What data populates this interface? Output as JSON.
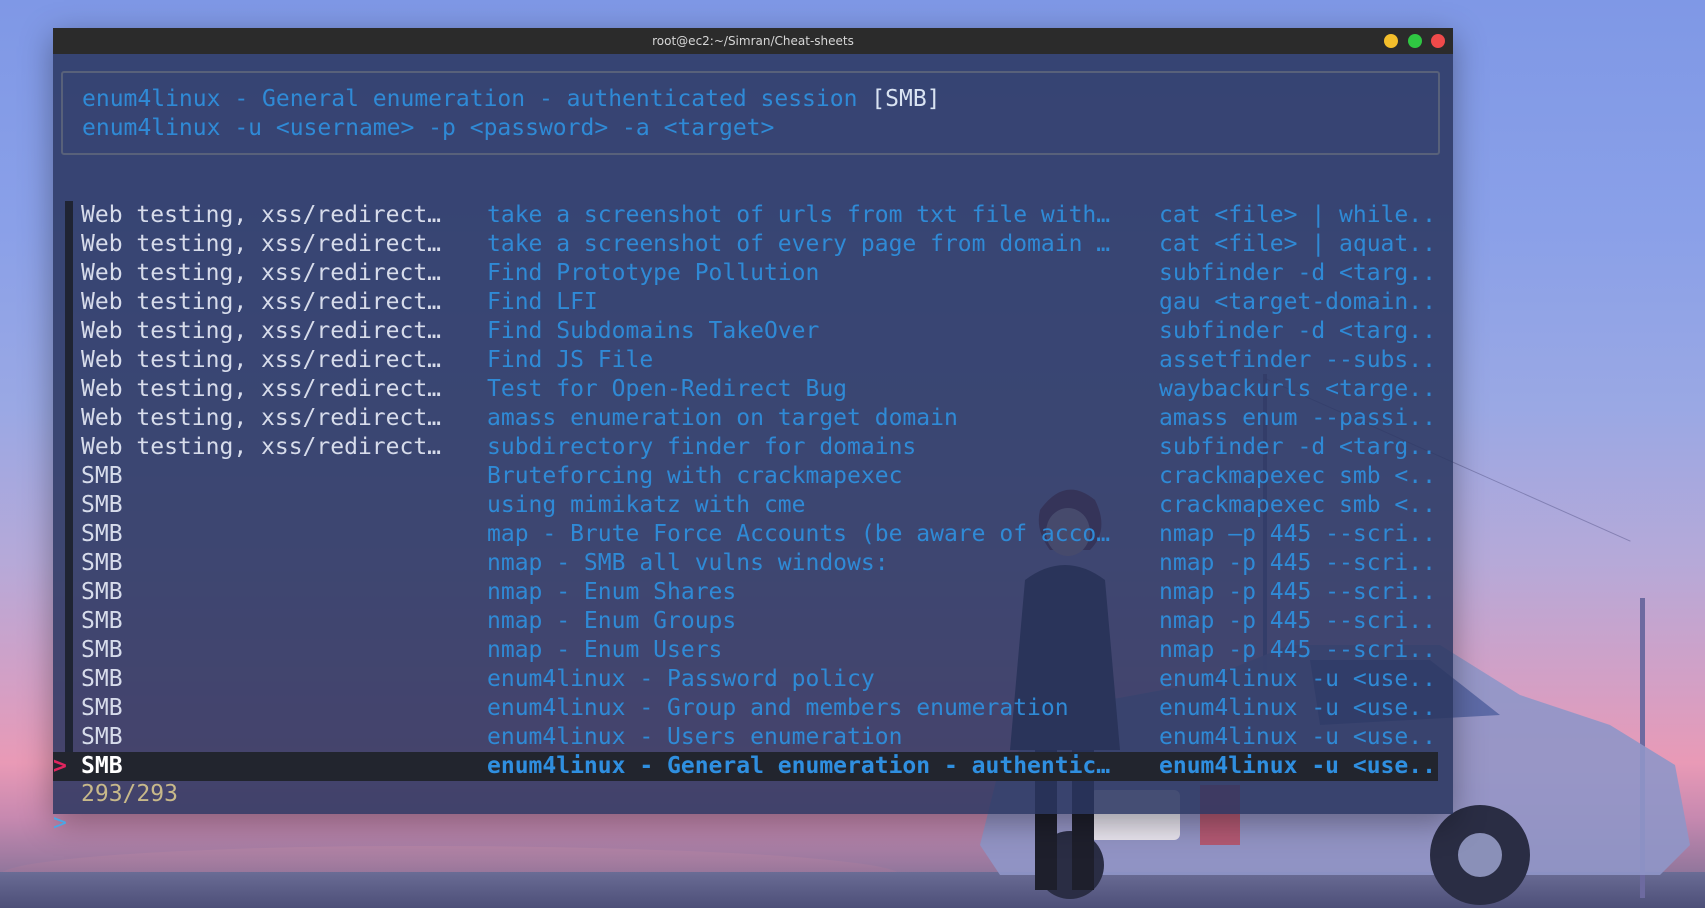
{
  "window": {
    "title": "root@ec2:~/Simran/Cheat-sheets",
    "controls": [
      "minimize",
      "maximize",
      "close"
    ]
  },
  "preview": {
    "line1": "enum4linux - General enumeration - authenticated session ",
    "tag": "[SMB]",
    "line2": "enum4linux -u <username> -p <password> -a <target>"
  },
  "rows": [
    {
      "c1": "Web testing, xss/redirect…",
      "c2": "take a screenshot of urls from txt file with…",
      "c3": "cat <file> | while.."
    },
    {
      "c1": "Web testing, xss/redirect…",
      "c2": "take a screenshot of every page from domain …",
      "c3": "cat <file> | aquat.."
    },
    {
      "c1": "Web testing, xss/redirect…",
      "c2": "Find Prototype Pollution",
      "c3": "subfinder -d <targ.."
    },
    {
      "c1": "Web testing, xss/redirect…",
      "c2": "Find LFI",
      "c3": "gau <target-domain.."
    },
    {
      "c1": "Web testing, xss/redirect…",
      "c2": "Find Subdomains TakeOver",
      "c3": "subfinder -d <targ.."
    },
    {
      "c1": "Web testing, xss/redirect…",
      "c2": "Find JS File",
      "c3": "assetfinder --subs.."
    },
    {
      "c1": "Web testing, xss/redirect…",
      "c2": "Test for Open-Redirect Bug",
      "c3": "waybackurls <targe.."
    },
    {
      "c1": "Web testing, xss/redirect…",
      "c2": "amass enumeration on target domain",
      "c3": "amass enum --passi.."
    },
    {
      "c1": "Web testing, xss/redirect…",
      "c2": "subdirectory finder for domains",
      "c3": "subfinder -d <targ.."
    },
    {
      "c1": "SMB",
      "c2": "Bruteforcing with crackmapexec",
      "c3": "crackmapexec smb <.."
    },
    {
      "c1": "SMB",
      "c2": "using mimikatz with cme",
      "c3": "crackmapexec smb <.."
    },
    {
      "c1": "SMB",
      "c2": "map - Brute Force Accounts (be aware of acco…",
      "c3": "nmap –p 445 --scri.."
    },
    {
      "c1": "SMB",
      "c2": "nmap - SMB all vulns windows:",
      "c3": "nmap -p 445 --scri.."
    },
    {
      "c1": "SMB",
      "c2": "nmap - Enum Shares",
      "c3": "nmap -p 445 --scri.."
    },
    {
      "c1": "SMB",
      "c2": "nmap - Enum Groups",
      "c3": "nmap -p 445 --scri.."
    },
    {
      "c1": "SMB",
      "c2": "nmap - Enum Users",
      "c3": "nmap -p 445 --scri.."
    },
    {
      "c1": "SMB",
      "c2": "enum4linux - Password policy",
      "c3": "enum4linux -u <use.."
    },
    {
      "c1": "SMB",
      "c2": "enum4linux - Group and members enumeration",
      "c3": "enum4linux -u <use.."
    },
    {
      "c1": "SMB",
      "c2": "enum4linux - Users enumeration",
      "c3": "enum4linux -u <use.."
    },
    {
      "c1": "SMB",
      "c2": "enum4linux - General enumeration - authentic…",
      "c3": "enum4linux -u <use.."
    }
  ],
  "selected_index": 19,
  "pointer": ">",
  "counter": "293/293",
  "prompt": ">",
  "colors": {
    "accent_blue": "#2f8ad6",
    "pointer_pink": "#e0245e",
    "counter_yellow": "#c8b98a"
  }
}
